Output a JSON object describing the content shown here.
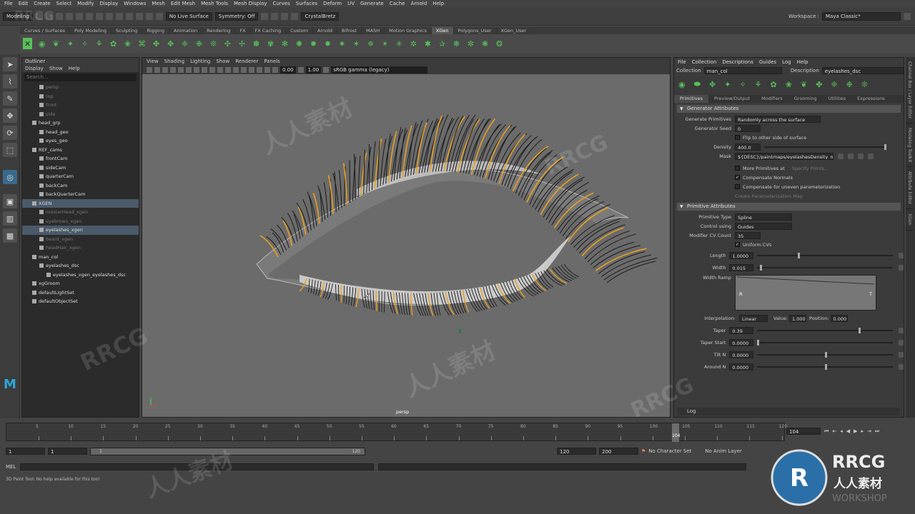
{
  "menubar": [
    "File",
    "Edit",
    "Create",
    "Select",
    "Modify",
    "Display",
    "Windows",
    "Mesh",
    "Edit Mesh",
    "Mesh Tools",
    "Mesh Display",
    "Curves",
    "Surfaces",
    "Deform",
    "UV",
    "Generate",
    "Cache",
    "Arnold",
    "Help"
  ],
  "status": {
    "mode": "Modeling",
    "live_surface": "No Live Surface",
    "symmetry": "Symmetry: Off",
    "user": "CrystalBretz",
    "workspace_label": "Workspace :",
    "workspace_value": "Maya Classic*"
  },
  "shelf_tabs": [
    "Curves / Surfaces",
    "Poly Modeling",
    "Sculpting",
    "Rigging",
    "Animation",
    "Rendering",
    "FX",
    "FX Caching",
    "Custom",
    "Arnold",
    "Bifrost",
    "MASH",
    "Motion Graphics",
    "XGen",
    "Polygons_User",
    "XGen_User"
  ],
  "shelf_active": "XGen",
  "outliner": {
    "title": "Outliner",
    "menu": [
      "Display",
      "Show",
      "Help"
    ],
    "search_placeholder": "Search...",
    "items": [
      {
        "label": "persp",
        "indent": 1,
        "dim": true
      },
      {
        "label": "top",
        "indent": 1,
        "dim": true
      },
      {
        "label": "front",
        "indent": 1,
        "dim": true
      },
      {
        "label": "side",
        "indent": 1,
        "dim": true
      },
      {
        "label": "head_grp",
        "indent": 0,
        "dim": false
      },
      {
        "label": "head_geo",
        "indent": 1,
        "dim": false
      },
      {
        "label": "eyes_geo",
        "indent": 1,
        "dim": false
      },
      {
        "label": "REF_cams",
        "indent": 0,
        "dim": false
      },
      {
        "label": "frontCam",
        "indent": 1,
        "dim": false
      },
      {
        "label": "sideCam",
        "indent": 1,
        "dim": false
      },
      {
        "label": "quarterCam",
        "indent": 1,
        "dim": false
      },
      {
        "label": "backCam",
        "indent": 1,
        "dim": false
      },
      {
        "label": "backQuarterCam",
        "indent": 1,
        "dim": false
      },
      {
        "label": "XGEN",
        "indent": 0,
        "dim": false
      },
      {
        "label": "masterHead_xgen",
        "indent": 1,
        "dim": true
      },
      {
        "label": "eyebrows_xgen",
        "indent": 1,
        "dim": true
      },
      {
        "label": "eyelashes_xgen",
        "indent": 1,
        "dim": false
      },
      {
        "label": "beard_xgen",
        "indent": 1,
        "dim": true
      },
      {
        "label": "headHair_xgen",
        "indent": 1,
        "dim": true
      },
      {
        "label": "man_col",
        "indent": 0,
        "dim": false
      },
      {
        "label": "eyelashes_dsc",
        "indent": 1,
        "dim": false
      },
      {
        "label": "eyelashes_xgen_eyelashes_dsc",
        "indent": 2,
        "dim": false
      },
      {
        "label": "xgGroom",
        "indent": 0,
        "dim": false
      },
      {
        "label": "defaultLightSet",
        "indent": 0,
        "dim": false
      },
      {
        "label": "defaultObjectSet",
        "indent": 0,
        "dim": false
      }
    ]
  },
  "viewport": {
    "menu": [
      "View",
      "Shading",
      "Lighting",
      "Show",
      "Renderer",
      "Panels"
    ],
    "exposure": "0.00",
    "gamma": "1.00",
    "colorspace": "sRGB gamma (legacy)",
    "camera_label": "persp"
  },
  "xgen": {
    "menu": [
      "File",
      "Collection",
      "Descriptions",
      "Guides",
      "Log",
      "Help"
    ],
    "collection_label": "Collection",
    "collection_value": "man_col",
    "description_label": "Description",
    "description_value": "eyelashes_dsc",
    "tabs": [
      "Primitives",
      "Preview/Output",
      "Modifiers",
      "Grooming",
      "Utilities",
      "Expressions"
    ],
    "active_tab": "Primitives",
    "generator_section": "Generator Attributes",
    "generate_primitives_label": "Generate Primitives",
    "generate_primitives_value": "Randomly across the surface",
    "seed_label": "Generator Seed",
    "seed_value": "0",
    "flip_label": "Flip to other side of surface",
    "density_label": "Density",
    "density_value": "400.0",
    "mask_label": "Mask",
    "mask_value": "${DESC}/paintmaps/eyelashesDensity_mask",
    "more_primitives_label": "More Primitives at",
    "specify_points_label": "Specify Points...",
    "compensate_normals_label": "Compensate Normals",
    "compensate_uneven_label": "Compensate for uneven parameterization",
    "create_map_label": "Create Parameterization Map",
    "primitive_section": "Primitive Attributes",
    "primitive_type_label": "Primitive Type",
    "primitive_type_value": "Spline",
    "control_using_label": "Control using",
    "control_using_value": "Guides",
    "modifier_cv_label": "Modifier CV Count",
    "modifier_cv_value": "35",
    "uniform_cvs_label": "Uniform CVs",
    "length_label": "Length",
    "length_value": "1.0000",
    "length_fraction": 0.3,
    "width_label": "Width",
    "width_value": "0.015",
    "width_fraction": 0.02,
    "width_ramp_label": "Width Ramp",
    "ramp_left": "R",
    "ramp_right": "T",
    "interpolation_label": "Interpolation:",
    "interpolation_value": "Linear",
    "value_label": "Value:",
    "value_value": "1.000",
    "position_label": "Position:",
    "position_value": "0.000",
    "taper_label": "Taper",
    "taper_value": "0.39",
    "taper_fraction": 0.75,
    "taper_start_label": "Taper Start",
    "taper_start_value": "0.0000",
    "tilt_label": "Tilt N",
    "tilt_value": "0.0000",
    "tilt_fraction": 0.5,
    "around_label": "Around N",
    "around_value": "0.0000",
    "around_fraction": 0.5,
    "log_label": "Log"
  },
  "side_tabs": [
    "Channel Box / Layer Editor",
    "Modeling Toolkit",
    "Attribute Editor",
    "XGen"
  ],
  "timeline": {
    "ticks": [
      "5",
      "10",
      "15",
      "20",
      "25",
      "30",
      "35",
      "40",
      "45",
      "50",
      "55",
      "60",
      "65",
      "70",
      "75",
      "80",
      "85",
      "90",
      "95",
      "100",
      "105",
      "110",
      "115",
      "120"
    ],
    "current_frame": "104"
  },
  "range": {
    "start": "1",
    "start2": "1",
    "slider_start": "1",
    "slider_end": "120",
    "end": "120",
    "end2": "200",
    "character_set": "No Character Set",
    "anim_layer": "No Anim Layer"
  },
  "cmdline": {
    "label": "MEL"
  },
  "helpline": "3D Paint Tool: No help available for this tool",
  "watermarks": [
    "RRCG",
    "人人素材"
  ],
  "logo": {
    "text1": "RRCG",
    "text2": "人人素材",
    "text3": "WORKSHOP"
  },
  "colors": {
    "accent_orange": "#e8a020",
    "xgen_green": "#58c05a",
    "viewport_bg": "#6b6b6b",
    "selection": "#4a5a6a"
  }
}
